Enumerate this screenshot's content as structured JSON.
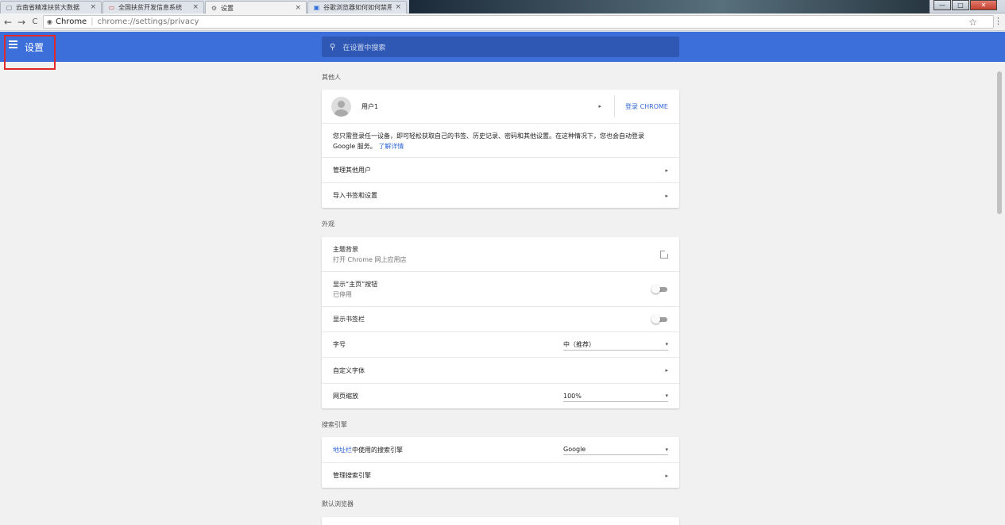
{
  "tabs": [
    {
      "title": "云南省精准扶贫大数据",
      "icon": "page-icon"
    },
    {
      "title": "全国扶贫开发信息系统",
      "icon": "site-icon"
    },
    {
      "title": "设置",
      "icon": "gear-icon",
      "active": true
    },
    {
      "title": "谷歌浏览器如何如何禁用",
      "icon": "site-icon"
    }
  ],
  "tab_close": "×",
  "window_controls": {
    "minimize": "—",
    "maximize": "□",
    "close": "✕"
  },
  "toolbar": {
    "back": "←",
    "forward": "→",
    "reload": "C",
    "host": "Chrome",
    "url": "chrome://settings/privacy",
    "bookmark_star": "☆",
    "menu": "⋮"
  },
  "header": {
    "title": "设置",
    "search_placeholder": "在设置中搜索"
  },
  "sections": {
    "people": {
      "title": "其他人",
      "user_name": "用户1",
      "signin_label": "登录 CHROME",
      "description": "您只需登录任一设备，即可轻松获取自己的书签、历史记录、密码和其他设置。在这种情况下，您也会自动登录 Google 服务。",
      "learn_more": "了解详情",
      "manage_users": "管理其他用户",
      "import_bookmarks": "导入书签和设置"
    },
    "appearance": {
      "title": "外观",
      "theme_label": "主题背景",
      "theme_sub": "打开 Chrome 网上应用店",
      "home_button_label": "显示“主页”按钮",
      "home_button_sub": "已停用",
      "bookmarks_bar_label": "显示书签栏",
      "font_size_label": "字号",
      "font_size_value": "中（推荐）",
      "custom_fonts_label": "自定义字体",
      "zoom_label": "网页缩放",
      "zoom_value": "100%"
    },
    "search_engine": {
      "title": "搜索引擎",
      "address_bar_link": "地址栏",
      "address_bar_rest": "中使用的搜索引擎",
      "engine_value": "Google",
      "manage_label": "管理搜索引擎"
    },
    "default_browser": {
      "title": "默认浏览器"
    }
  },
  "glyphs": {
    "arrow": "▸",
    "caret": "▾",
    "search": "🔍",
    "ext": "↗"
  }
}
